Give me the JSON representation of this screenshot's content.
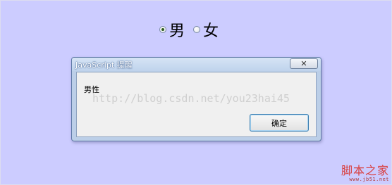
{
  "radios": [
    {
      "label": "男",
      "checked": true
    },
    {
      "label": "女",
      "checked": false
    }
  ],
  "dialog": {
    "title": "JavaScript 提醒",
    "close_symbol": "✕",
    "message": "男性",
    "ok_label": "确定"
  },
  "watermark": {
    "url": "http://blog.csdn.net/you23hai45"
  },
  "site_badge": {
    "name": "脚本之家",
    "url": "www.jb51.net"
  }
}
